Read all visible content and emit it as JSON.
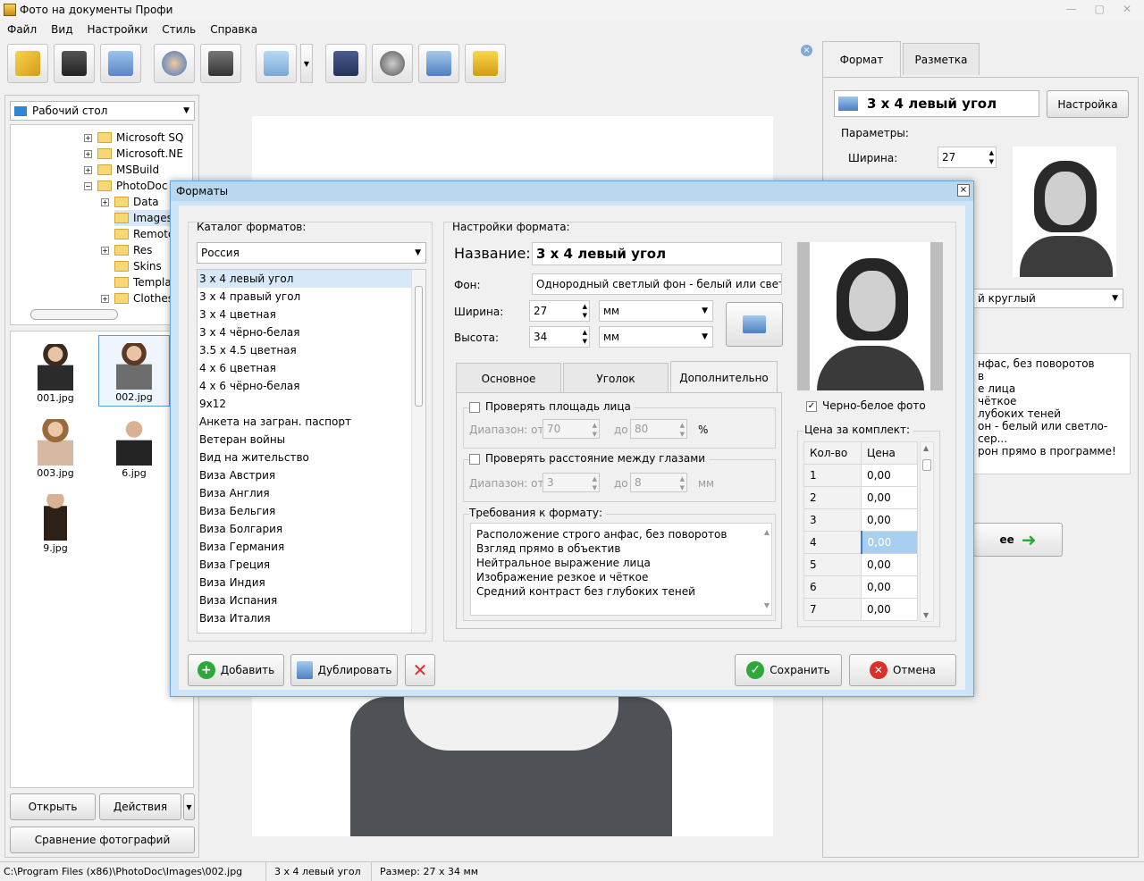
{
  "window": {
    "title": "Фото на документы Профи",
    "min": "—",
    "max": "▢",
    "close": "✕"
  },
  "menu": [
    "Файл",
    "Вид",
    "Настройки",
    "Стиль",
    "Справка"
  ],
  "toolbar": {
    "close": "×"
  },
  "left": {
    "location": "Рабочий стол",
    "tree": [
      "Microsoft SQ",
      "Microsoft.NE",
      "MSBuild",
      "PhotoDoc",
      "Data",
      "Images",
      "Remote",
      "Res",
      "Skins",
      "Templa",
      "Clothes"
    ],
    "thumbs": [
      "001.jpg",
      "002.jpg",
      "003.jpg",
      "6.jpg",
      "9.jpg"
    ],
    "open": "Открыть",
    "actions": "Действия",
    "compare": "Сравнение фотографий"
  },
  "right": {
    "tab_format": "Формат",
    "tab_layout": "Разметка",
    "format": "3 х 4 левый угол",
    "setup": "Настройка",
    "params": "Параметры:",
    "width_label": "Ширина:",
    "width": "27",
    "shape": "й круглый",
    "req": [
      "нфас, без поворотов",
      "в",
      "е лица",
      "чёткое",
      "лубоких теней",
      "он - белый или светло-сер...",
      "рон прямо в программе!"
    ],
    "next": "ее"
  },
  "status": {
    "path": "C:\\Program Files (x86)\\PhotoDoc\\Images\\002.jpg",
    "format": "3 х 4 левый угол",
    "size": "Размер: 27 х 34 мм"
  },
  "dialog": {
    "title": "Форматы",
    "close": "×",
    "catalog_label": "Каталог форматов:",
    "country": "Россия",
    "formats": [
      "3 х 4 левый угол",
      "3 х 4 правый угол",
      "3 х 4 цветная",
      "3 х 4 чёрно-белая",
      "3.5 х 4.5 цветная",
      "4 х 6 цветная",
      "4 х 6 чёрно-белая",
      "9х12",
      "Анкета на заг­ран. паспорт",
      "Ветеран войны",
      "Вид на жительство",
      "Виза Австрия",
      "Виза Англия",
      "Виза Бельгия",
      "Виза Болгария",
      "Виза Германия",
      "Виза Греция",
      "Виза Индия",
      "Виза Испания",
      "Виза Италия"
    ],
    "settings_label": "Настройки формата:",
    "name_label": "Название:",
    "name": "3 х 4 левый угол",
    "bg_label": "Фон:",
    "bg": "Однородный светлый фон - белый или светло-",
    "w_label": "Ширина:",
    "w": "27",
    "h_label": "Высота:",
    "h": "34",
    "unit": "мм",
    "tabs": [
      "Основное",
      "Уголок",
      "Дополнительно"
    ],
    "check_face": "Проверять площадь лица",
    "range_from": "Диапазон: от",
    "to": "до",
    "face_from": "70",
    "face_to": "80",
    "pct": "%",
    "check_eyes": "Проверять расстояние между глазами",
    "eyes_from": "3",
    "eyes_to": "8",
    "mm": "мм",
    "req_label": "Требования к формату:",
    "req": [
      "Расположение строго анфас, без поворотов",
      "Взгляд прямо в объектив",
      "Нейтральное выражение лица",
      "Изображение резкое и чёткое",
      "Средний контраст без глубоких теней"
    ],
    "bw": "Черно-белое фото",
    "price_label": "Цена за комплект:",
    "col_qty": "Кол-во",
    "col_price": "Цена",
    "prices": [
      [
        "1",
        "0,00"
      ],
      [
        "2",
        "0,00"
      ],
      [
        "3",
        "0,00"
      ],
      [
        "4",
        "0,00"
      ],
      [
        "5",
        "0,00"
      ],
      [
        "6",
        "0,00"
      ],
      [
        "7",
        "0,00"
      ]
    ],
    "add": "Добавить",
    "dup": "Дублировать",
    "save": "Сохранить",
    "cancel": "Отмена"
  },
  "colors": {
    "accent": "#6da4d6",
    "green": "#2fa83a",
    "red": "#d9302b"
  }
}
